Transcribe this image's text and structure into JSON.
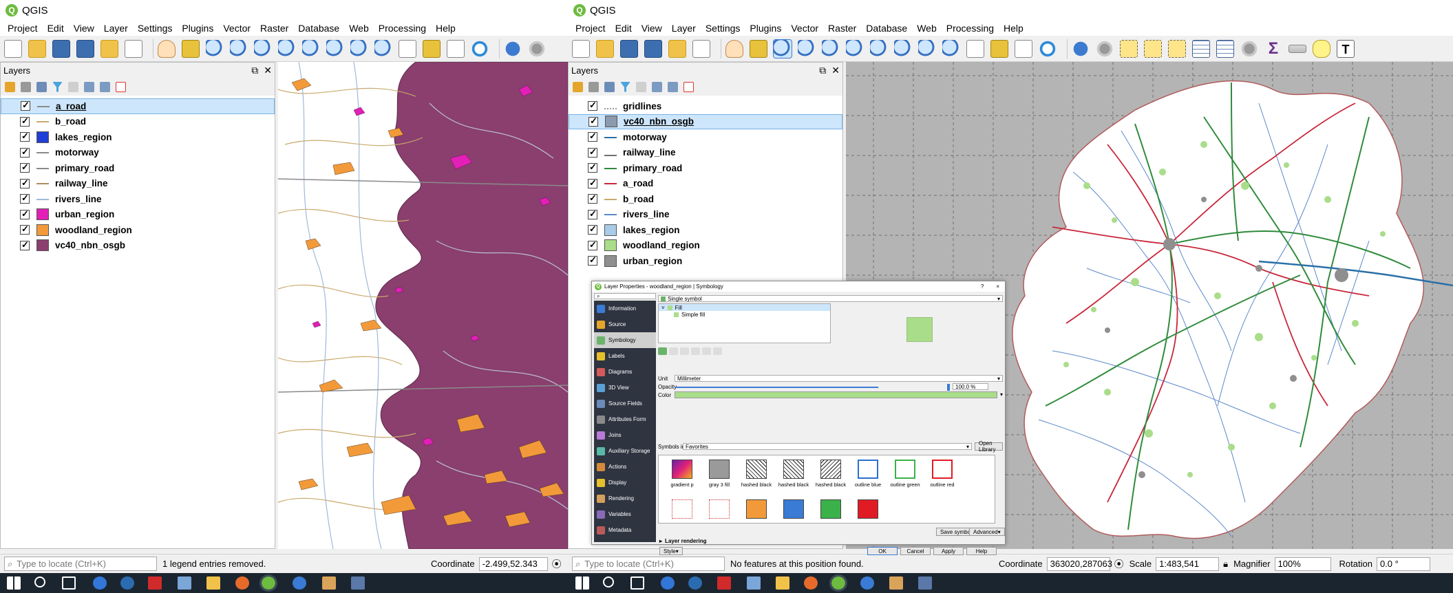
{
  "left_window": {
    "title": "QGIS",
    "menu": [
      "Project",
      "Edit",
      "View",
      "Layer",
      "Settings",
      "Plugins",
      "Vector",
      "Raster",
      "Database",
      "Web",
      "Processing",
      "Help"
    ],
    "layers_panel_title": "Layers",
    "layers": [
      {
        "name": "a_road",
        "symbol": "line",
        "color": "#8a8a8a",
        "selected": true
      },
      {
        "name": "b_road",
        "symbol": "line",
        "color": "#c9a96b",
        "selected": false
      },
      {
        "name": "lakes_region",
        "symbol": "fill",
        "color": "#1f3fd6",
        "selected": false
      },
      {
        "name": "motorway",
        "symbol": "line",
        "color": "#8a8a8a",
        "selected": false
      },
      {
        "name": "primary_road",
        "symbol": "line",
        "color": "#8a8a8a",
        "selected": false
      },
      {
        "name": "railway_line",
        "symbol": "line",
        "color": "#b08b5c",
        "selected": false
      },
      {
        "name": "rivers_line",
        "symbol": "line",
        "color": "#a0b8d8",
        "selected": false
      },
      {
        "name": "urban_region",
        "symbol": "fill",
        "color": "#e21fb6",
        "selected": false
      },
      {
        "name": "woodland_region",
        "symbol": "fill",
        "color": "#f29a3a",
        "selected": false
      },
      {
        "name": "vc40_nbn_osgb",
        "symbol": "fill",
        "color": "#8a3f6e",
        "selected": false
      }
    ],
    "status": {
      "locate_placeholder": "Type to locate (Ctrl+K)",
      "message": "1 legend entries removed.",
      "coordinate_label": "Coordinate",
      "coordinate_value": "-2.499,52.343"
    }
  },
  "right_window": {
    "title": "QGIS",
    "menu": [
      "Project",
      "Edit",
      "View",
      "Layer",
      "Settings",
      "Plugins",
      "Vector",
      "Raster",
      "Database",
      "Web",
      "Processing",
      "Help"
    ],
    "layers_panel_title": "Layers",
    "layers": [
      {
        "name": "gridlines",
        "symbol": "dash",
        "color": "#9a9a9a",
        "selected": false
      },
      {
        "name": "vc40_nbn_osgb",
        "symbol": "fill",
        "color": "#8c9aae",
        "selected": true
      },
      {
        "name": "motorway",
        "symbol": "line",
        "color": "#2a6fa8",
        "selected": false
      },
      {
        "name": "railway_line",
        "symbol": "rail",
        "color": "#707070",
        "selected": false
      },
      {
        "name": "primary_road",
        "symbol": "line",
        "color": "#2e8b3a",
        "selected": false
      },
      {
        "name": "a_road",
        "symbol": "line",
        "color": "#c8263a",
        "selected": false
      },
      {
        "name": "b_road",
        "symbol": "line",
        "color": "#c9a96b",
        "selected": false
      },
      {
        "name": "rivers_line",
        "symbol": "line",
        "color": "#5a88c8",
        "selected": false
      },
      {
        "name": "lakes_region",
        "symbol": "fill",
        "color": "#a9cce8",
        "selected": false
      },
      {
        "name": "woodland_region",
        "symbol": "fill",
        "color": "#a9dd8a",
        "selected": false
      },
      {
        "name": "urban_region",
        "symbol": "fill",
        "color": "#8f8f8f",
        "selected": false
      }
    ],
    "status": {
      "locate_placeholder": "Type to locate (Ctrl+K)",
      "message": "No features at this position found.",
      "coordinate_label": "Coordinate",
      "coordinate_value": "363020,287063",
      "scale_label": "Scale",
      "scale_value": "1:483,541",
      "magnifier_label": "Magnifier",
      "magnifier_value": "100%",
      "rotation_label": "Rotation",
      "rotation_value": "0.0 °"
    }
  },
  "dialog": {
    "title": "Layer Properties - woodland_region | Symbology",
    "help": "?",
    "close": "×",
    "renderer": "Single symbol",
    "tabs": [
      "Information",
      "Source",
      "Symbology",
      "Labels",
      "Diagrams",
      "3D View",
      "Source Fields",
      "Attributes Form",
      "Joins",
      "Auxiliary Storage",
      "Actions",
      "Display",
      "Rendering",
      "Variables",
      "Metadata"
    ],
    "active_tab": "Symbology",
    "tree_fill": "Fill",
    "tree_simple_fill": "Simple fill",
    "unit_label": "Unit",
    "unit_value": "Millimeter",
    "opacity_label": "Opacity",
    "opacity_value": "100.0 %",
    "color_label": "Color",
    "fill_color": "#a9dd8a",
    "symbols_in_label": "Symbols in",
    "symbols_in_value": "Favorites",
    "open_library": "Open Library",
    "symbols": [
      {
        "label": "gradient   p",
        "kind": "gradient"
      },
      {
        "label": "gray 3 fill",
        "kind": "gray"
      },
      {
        "label": "hashed black",
        "kind": "hash"
      },
      {
        "label": "hashed black",
        "kind": "cross"
      },
      {
        "label": "hashed black",
        "kind": "hash2"
      },
      {
        "label": "outline blue",
        "kind": "outline",
        "color": "#2b6fd1"
      },
      {
        "label": "outline green",
        "kind": "outline",
        "color": "#3bb14a"
      },
      {
        "label": "outline red",
        "kind": "outline",
        "color": "#e01b24"
      }
    ],
    "save_symbol": "Save symbol",
    "advanced": "Advanced",
    "layer_rendering": "Layer rendering",
    "style": "Style",
    "ok": "OK",
    "cancel": "Cancel",
    "apply": "Apply",
    "help_btn": "Help"
  }
}
